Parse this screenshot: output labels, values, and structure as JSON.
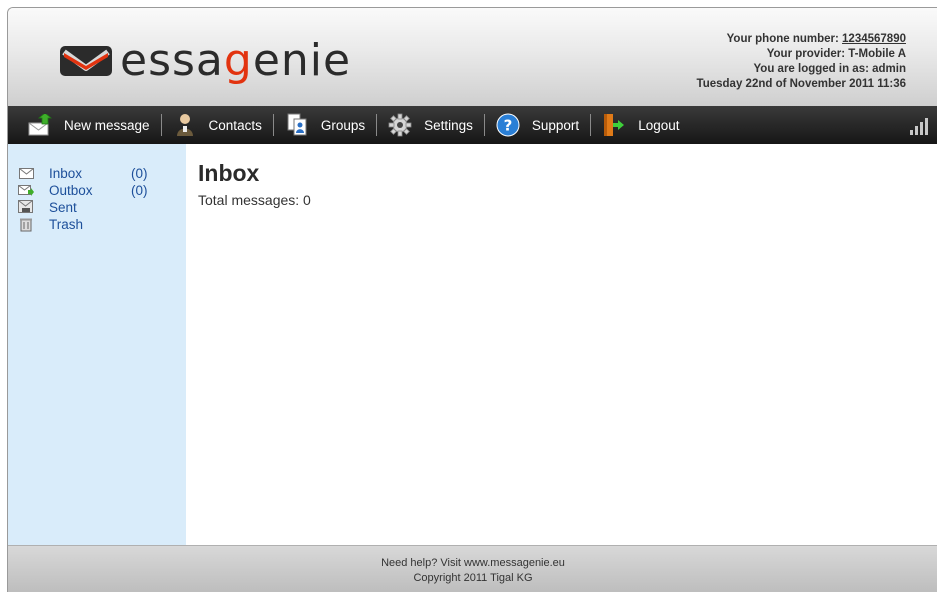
{
  "header": {
    "logo_text_pre": "ess",
    "logo_text_g": "a",
    "logo_text_accent": "g",
    "logo_text_post": "enie",
    "phone_label": "Your phone number: ",
    "phone_value": "1234567890",
    "provider": "Your provider: T-Mobile A",
    "logged_in": "You are logged in as: admin",
    "date_prefix": "Tuesday 22nd of November 2011 ",
    "time": "11:36"
  },
  "nav": {
    "items": [
      {
        "label": "New message",
        "icon": "new-message-icon"
      },
      {
        "label": "Contacts",
        "icon": "contacts-icon"
      },
      {
        "label": "Groups",
        "icon": "groups-icon"
      },
      {
        "label": "Settings",
        "icon": "settings-icon"
      },
      {
        "label": "Support",
        "icon": "support-icon"
      },
      {
        "label": "Logout",
        "icon": "logout-icon"
      }
    ]
  },
  "sidebar": {
    "folders": [
      {
        "name": "Inbox",
        "count": "(0)",
        "icon": "inbox-icon"
      },
      {
        "name": "Outbox",
        "count": "(0)",
        "icon": "outbox-icon"
      },
      {
        "name": "Sent",
        "count": "",
        "icon": "sent-icon"
      },
      {
        "name": "Trash",
        "count": "",
        "icon": "trash-icon"
      }
    ]
  },
  "main": {
    "title": "Inbox",
    "total": "Total messages: 0"
  },
  "footer": {
    "help": "Need help? Visit www.messagenie.eu",
    "copyright": "Copyright 2011 Tigal KG"
  },
  "colors": {
    "accent": "#e2330f",
    "link": "#1d4f9a",
    "sidebar_bg": "#d9ecfa"
  }
}
